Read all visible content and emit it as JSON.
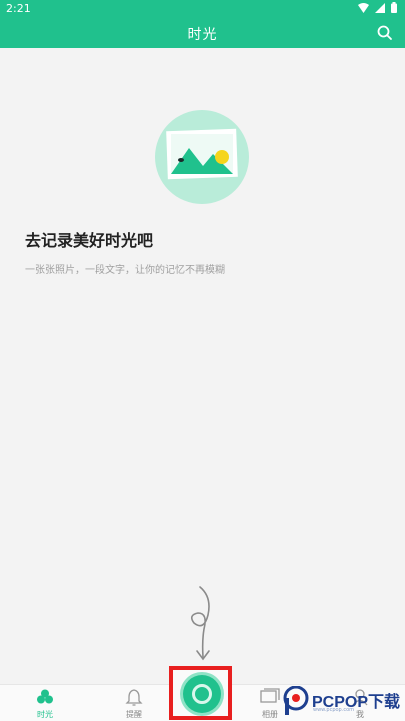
{
  "status_bar": {
    "time": "2:21"
  },
  "app_bar": {
    "title": "时光"
  },
  "empty_state": {
    "title": "去记录美好时光吧",
    "subtitle": "一张张照片，一段文字，让你的记忆不再模糊"
  },
  "bottom_nav": {
    "items": [
      {
        "label": "时光",
        "icon": "clover-icon",
        "active": true
      },
      {
        "label": "提醒",
        "icon": "bell-icon",
        "active": false
      },
      {
        "label": "相册",
        "icon": "album-icon",
        "active": false
      },
      {
        "label": "我",
        "icon": "person-icon",
        "active": false
      }
    ],
    "record_icon": "record-circle-icon"
  },
  "watermark": {
    "brand": "PCPOP下载",
    "sub": "www.pcpop.com"
  },
  "colors": {
    "accent": "#20c18d",
    "highlight": "#e81f1f",
    "background": "#f3f3f3"
  }
}
